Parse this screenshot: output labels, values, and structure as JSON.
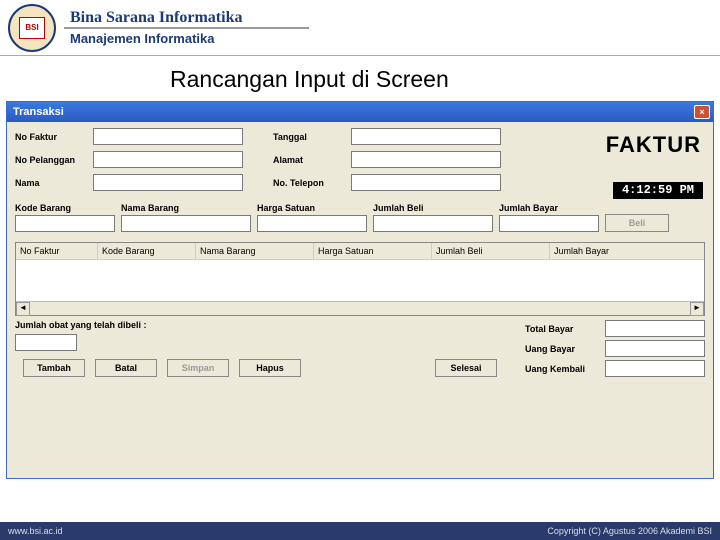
{
  "banner": {
    "line1": "Bina Sarana Informatika",
    "line2": "Manajemen Informatika",
    "logo_text": "BSI"
  },
  "slide_title": "Rancangan Input di Screen",
  "window": {
    "title": "Transaksi",
    "close": "×"
  },
  "form": {
    "no_faktur_label": "No Faktur",
    "tanggal_label": "Tanggal",
    "no_pelanggan_label": "No Pelanggan",
    "alamat_label": "Alamat",
    "nama_label": "Nama",
    "no_telepon_label": "No. Telepon",
    "no_faktur": "",
    "tanggal": "",
    "no_pelanggan": "",
    "alamat": "",
    "nama": "",
    "no_telepon": ""
  },
  "heading_big": "FAKTUR",
  "time_display": "4:12:59 PM",
  "item_entry": {
    "kode_label": "Kode Barang",
    "nama_label": "Nama Barang",
    "harga_label": "Harga Satuan",
    "jbeli_label": "Jumlah Beli",
    "jbayar_label": "Jumlah Bayar",
    "kode": "",
    "nama": "",
    "harga": "",
    "jbeli": "",
    "jbayar": "",
    "beli_btn": "Beli"
  },
  "grid": {
    "col_no": "No Faktur",
    "col_kode": "Kode Barang",
    "col_nama": "Nama Barang",
    "col_harga": "Harga Satuan",
    "col_jbeli": "Jumlah Beli",
    "col_jbayar": "Jumlah Bayar"
  },
  "count": {
    "label": "Jumlah obat yang telah dibeli :",
    "value": ""
  },
  "totals": {
    "total_label": "Total Bayar",
    "total": "",
    "uang_label": "Uang Bayar",
    "uang": "",
    "kembali_label": "Uang Kembali",
    "kembali": ""
  },
  "actions": {
    "tambah": "Tambah",
    "batal": "Batal",
    "simpan": "Simpan",
    "hapus": "Hapus",
    "selesai": "Selesai"
  },
  "footer": {
    "left": "www.bsi.ac.id",
    "right": "Copyright (C) Agustus 2006 Akademi BSI"
  }
}
